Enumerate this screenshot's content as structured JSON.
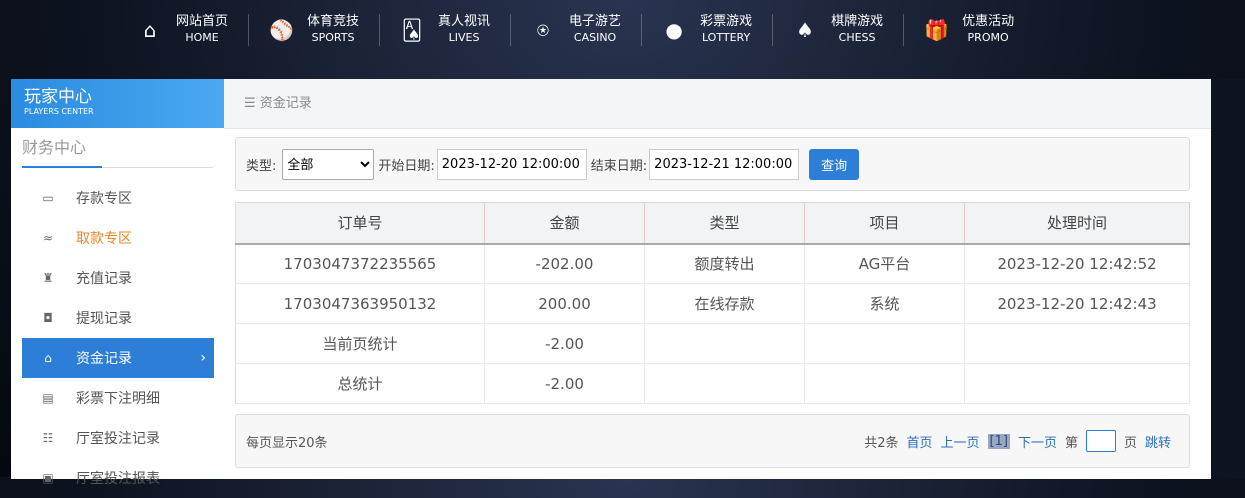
{
  "nav": [
    {
      "cn": "网站首页",
      "en": "HOME",
      "icon": "home-icon",
      "glyph": "⌂"
    },
    {
      "cn": "体育竞技",
      "en": "SPORTS",
      "icon": "ball-icon",
      "glyph": "⚾"
    },
    {
      "cn": "真人视讯",
      "en": "LIVES",
      "icon": "cards-icon",
      "glyph": "🂡"
    },
    {
      "cn": "电子游艺",
      "en": "CASINO",
      "icon": "joystick-icon",
      "glyph": "⍟"
    },
    {
      "cn": "彩票游戏",
      "en": "LOTTERY",
      "icon": "lottery-balls-icon",
      "glyph": "●"
    },
    {
      "cn": "棋牌游戏",
      "en": "CHESS",
      "icon": "spade-icon",
      "glyph": "♠"
    },
    {
      "cn": "优惠活动",
      "en": "PROMO",
      "icon": "gift-icon",
      "glyph": "🎁"
    }
  ],
  "sidebar": {
    "title": "玩家中心",
    "subtitle": "PLAYERS CENTER",
    "section": "财务中心",
    "items": [
      {
        "label": "存款专区",
        "glyph": "▭"
      },
      {
        "label": "取款专区",
        "glyph": "≈"
      },
      {
        "label": "充值记录",
        "glyph": "♜"
      },
      {
        "label": "提现记录",
        "glyph": "◘"
      },
      {
        "label": "资金记录",
        "glyph": "⌂",
        "arrow": "›"
      },
      {
        "label": "彩票下注明细",
        "glyph": "▤"
      },
      {
        "label": "厅室投注记录",
        "glyph": "☷"
      },
      {
        "label": "厅室投注报表",
        "glyph": "▣"
      }
    ]
  },
  "breadcrumb": {
    "icon": "☰",
    "label": "资金记录"
  },
  "filter": {
    "type_label": "类型:",
    "type_value": "全部",
    "start_label": "开始日期:",
    "start_value": "2023-12-20 12:00:00",
    "end_label": "结束日期:",
    "end_value": "2023-12-21 12:00:00",
    "query": "查询"
  },
  "table": {
    "headers": [
      "订单号",
      "金额",
      "类型",
      "项目",
      "处理时间"
    ],
    "rows": [
      [
        "1703047372235565",
        "-202.00",
        "额度转出",
        "AG平台",
        "2023-12-20 12:42:52"
      ],
      [
        "1703047363950132",
        "200.00",
        "在线存款",
        "系统",
        "2023-12-20 12:42:43"
      ],
      [
        "当前页统计",
        "-2.00",
        "",
        "",
        ""
      ],
      [
        "总统计",
        "-2.00",
        "",
        "",
        ""
      ]
    ]
  },
  "pager": {
    "per_page": "每页显示20条",
    "total": "共2条",
    "first": "首页",
    "prev": "上一页",
    "current": "[1]",
    "next": "下一页",
    "page_pre": "第",
    "page_post": "页",
    "jump": "跳转"
  }
}
